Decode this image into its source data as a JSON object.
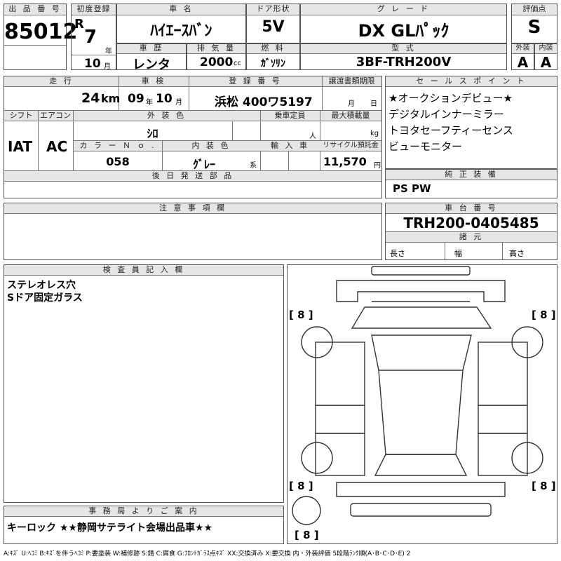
{
  "header": {
    "lot_label": "出 品 番 号",
    "lot_no": "85012",
    "first_reg_label": "初度登録",
    "era": "R",
    "year": "7",
    "year_unit": "年",
    "month": "10",
    "month_unit": "月",
    "car_name_label": "車 名",
    "car_name": "ﾊｲｴｰｽﾊﾞﾝ",
    "door_label": "ドア形状",
    "door": "5V",
    "grade_label": "グ レ ー ド",
    "grade": "DX GLﾊﾟｯｸ",
    "score_label": "評価点",
    "score": "S",
    "history_label": "車 歴",
    "history": "レンタ",
    "displacement_label": "排 気 量",
    "displacement": "2000",
    "displacement_unit": "cc",
    "fuel_label": "燃 料",
    "fuel": "ｶﾞｿﾘﾝ",
    "model_label": "型 式",
    "model": "3BF-TRH200V",
    "ext_label": "外装",
    "ext": "A",
    "int_label": "内装",
    "int": "A"
  },
  "row2": {
    "mileage_label": "走 行",
    "mileage": "24",
    "mileage_unit": "km",
    "inspection_label": "車 検",
    "insp_year": "09",
    "insp_year_unit": "年",
    "insp_month": "10",
    "insp_month_unit": "月",
    "plate_label": "登 録 番 号",
    "plate": "浜松 400ワ5197",
    "transfer_label": "譲渡書類期限",
    "transfer_month_unit": "月",
    "transfer_day_unit": "日",
    "shift_label": "シフト",
    "shift": "IAT",
    "ac_label": "エアコン",
    "ac": "AC",
    "exterior_color_label": "外 装 色",
    "exterior_color": "ｼﾛ",
    "capacity_label": "乗車定員",
    "capacity_unit": "人",
    "max_load_label": "最大積載量",
    "max_load_unit": "kg",
    "color_no_label": "カ ラ ー Ｎ ｏ .",
    "color_no": "058",
    "interior_color_label": "内 装 色",
    "interior_color": "ｸﾞﾚｰ",
    "interior_suffix": "系",
    "import_label": "輸 入 車",
    "recycle_label": "リサイクル預託金",
    "recycle": "11,570",
    "recycle_unit": "円",
    "later_parts_label": "後 日 発 送 部 品"
  },
  "sales": {
    "label": "セ ー ル ス ポ イ ン ト",
    "points": [
      "★オークションデビュー★",
      "デジタルインナーミラー",
      "トヨタセーフティーセンス",
      "ビューモニター"
    ]
  },
  "genuine": {
    "label": "純 正 装 備",
    "value": "PS PW"
  },
  "notes": {
    "label": "注 意 事 項 欄"
  },
  "chassis": {
    "label": "車 台 番 号",
    "value": "TRH200-0405485",
    "specs_label": "諸 元",
    "length": "長さ",
    "width": "幅",
    "height": "高さ"
  },
  "inspector": {
    "label": "検 査 員 記 入 欄",
    "lines": [
      "ステレオレス穴",
      "Sドア固定ガラス"
    ]
  },
  "diagram": {
    "marks": [
      "[ 8 ]",
      "[ 8 ]",
      "[ 8 ]",
      "[ 8 ]",
      "[ 8 ]"
    ]
  },
  "office": {
    "label": "事 務 局 よ り ご 案 内",
    "text": "キーロック ★★静岡サテライト会場出品車★★"
  },
  "legend": "A:ｷｽﾞ U:ﾍｺﾐ B:ｷｽﾞを伴うﾍｺﾐ P:要塗装 W:補修跡 S:錆 C:腐食 G:ﾌﾛﾝﾄｶﾞﾗｽ点ｷｽﾞ XX:交換済み X:要交換 内・外装評価 5段階ﾗﾝｸ順(A･B･C･D･E) 2"
}
